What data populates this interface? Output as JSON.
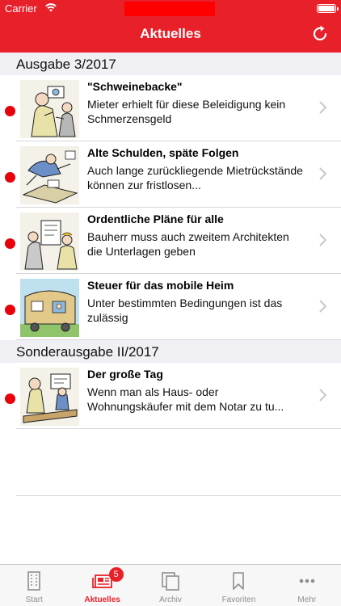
{
  "status_bar": {
    "carrier": "Carrier"
  },
  "nav": {
    "title": "Aktuelles"
  },
  "sections": [
    {
      "title": "Ausgabe 3/2017",
      "items": [
        {
          "title": "\"Schweinebacke\"",
          "subtitle": "Mieter erhielt für diese Beleidigung kein Schmerzensgeld",
          "unread": true
        },
        {
          "title": "Alte Schulden, späte Folgen",
          "subtitle": "Auch lange zurückliegende Mietrückstände können zur fristlosen...",
          "unread": true
        },
        {
          "title": "Ordentliche Pläne für alle",
          "subtitle": "Bauherr muss auch zweitem Architekten die Unterlagen geben",
          "unread": true
        },
        {
          "title": "Steuer für das mobile Heim",
          "subtitle": "Unter bestimmten Bedingungen ist das zulässig",
          "unread": true
        }
      ]
    },
    {
      "title": "Sonderausgabe II/2017",
      "items": [
        {
          "title": "Der große Tag",
          "subtitle": "Wenn man als Haus- oder Wohnungskäufer mit dem Notar zu tu...",
          "unread": true
        }
      ]
    }
  ],
  "tabs": [
    {
      "label": "Start",
      "icon": "building-icon",
      "active": false
    },
    {
      "label": "Aktuelles",
      "icon": "newspaper-icon",
      "active": true,
      "badge": "5"
    },
    {
      "label": "Archiv",
      "icon": "stacked-pages-icon",
      "active": false
    },
    {
      "label": "Favoriten",
      "icon": "bookmark-icon",
      "active": false
    },
    {
      "label": "Mehr",
      "icon": "more-dots-icon",
      "active": false
    }
  ],
  "colors": {
    "brand_red": "#e8202a",
    "unread_dot": "#e8000a",
    "tab_inactive": "#8e8e93"
  }
}
